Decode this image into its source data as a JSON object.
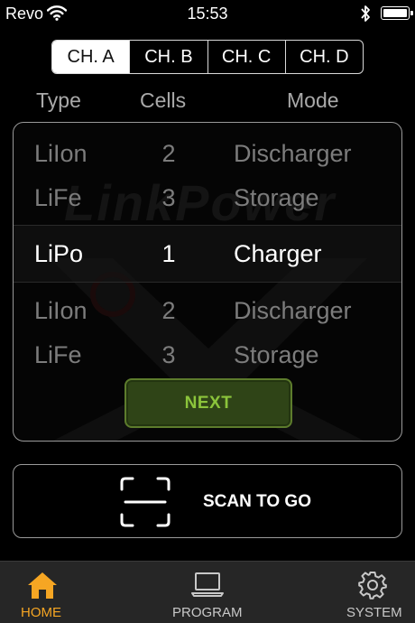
{
  "status_bar": {
    "carrier": "Revo",
    "time": "15:53"
  },
  "channel_tabs": [
    {
      "label": "CH. A",
      "active": true
    },
    {
      "label": "CH. B",
      "active": false
    },
    {
      "label": "CH. C",
      "active": false
    },
    {
      "label": "CH. D",
      "active": false
    }
  ],
  "columns": {
    "type": "Type",
    "cells": "Cells",
    "mode": "Mode"
  },
  "picker": {
    "watermark": "LinkPower",
    "rows": [
      {
        "type": "LiIon",
        "cells": "2",
        "mode": "Discharger",
        "selected": false
      },
      {
        "type": "LiFe",
        "cells": "3",
        "mode": "Storage",
        "selected": false
      },
      {
        "type": "LiPo",
        "cells": "1",
        "mode": "Charger",
        "selected": true
      },
      {
        "type": "LiIon",
        "cells": "2",
        "mode": "Discharger",
        "selected": false
      },
      {
        "type": "LiFe",
        "cells": "3",
        "mode": "Storage",
        "selected": false
      }
    ],
    "next_label": "NEXT"
  },
  "scan": {
    "label": "SCAN TO GO",
    "icon": "scan-frame-icon"
  },
  "tabbar": {
    "items": [
      {
        "label": "HOME",
        "icon": "home-icon",
        "active": true
      },
      {
        "label": "PROGRAM",
        "icon": "laptop-icon",
        "active": false
      },
      {
        "label": "SYSTEM",
        "icon": "gear-icon",
        "active": false
      }
    ]
  },
  "colors": {
    "accent_home": "#f6a623",
    "next_text": "#8bc43b",
    "next_bg": "#2f4417"
  }
}
